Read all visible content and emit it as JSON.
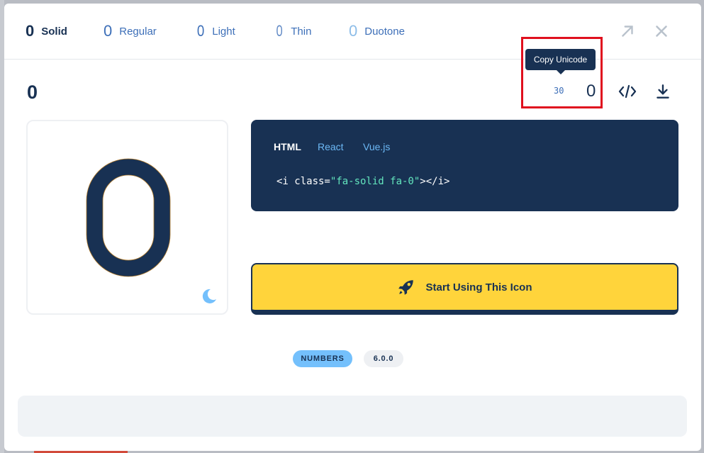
{
  "tabs": [
    {
      "glyph": "0",
      "label": "Solid"
    },
    {
      "glyph": "0",
      "label": "Regular"
    },
    {
      "glyph": "0",
      "label": "Light"
    },
    {
      "glyph": "0",
      "label": "Thin"
    },
    {
      "glyph": "0",
      "label": "Duotone"
    }
  ],
  "icon": {
    "title": "0",
    "unicode": "30",
    "unicode_glyph": "0",
    "tooltip": "Copy Unicode"
  },
  "code": {
    "tabs": [
      "HTML",
      "React",
      "Vue.js"
    ],
    "line_prefix": "<i class=",
    "line_string": "\"fa-solid fa-0\"",
    "line_suffix": "></i>"
  },
  "cta": {
    "label": "Start Using This Icon"
  },
  "tags": {
    "category": "NUMBERS",
    "version": "6.0.0"
  },
  "colors": {
    "navy": "#183153",
    "blue": "#3d6fb8",
    "light_blue": "#74c0fc",
    "yellow": "#ffd43b",
    "highlight_red": "#e0101e"
  }
}
